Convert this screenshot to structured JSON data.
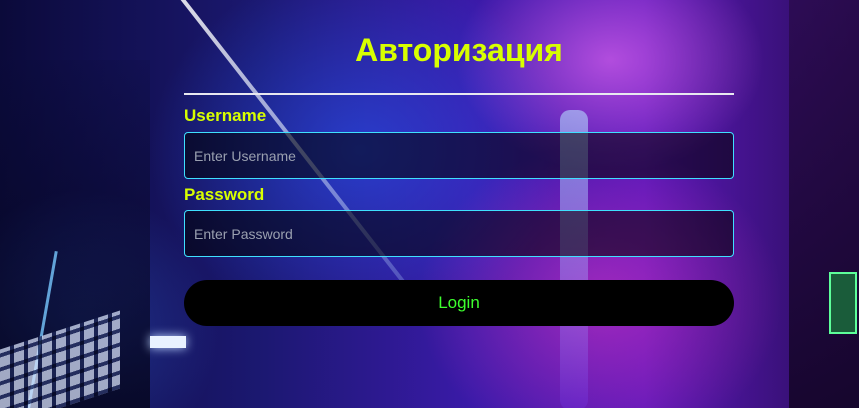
{
  "page": {
    "title": "Авторизация"
  },
  "form": {
    "username": {
      "label": "Username",
      "placeholder": "Enter Username",
      "value": ""
    },
    "password": {
      "label": "Password",
      "placeholder": "Enter Password",
      "value": ""
    },
    "login_label": "Login"
  },
  "colors": {
    "accent_text": "#d8ff00",
    "button_text": "#3dff2e",
    "input_border": "#3fe0ff",
    "button_bg": "#000000"
  }
}
